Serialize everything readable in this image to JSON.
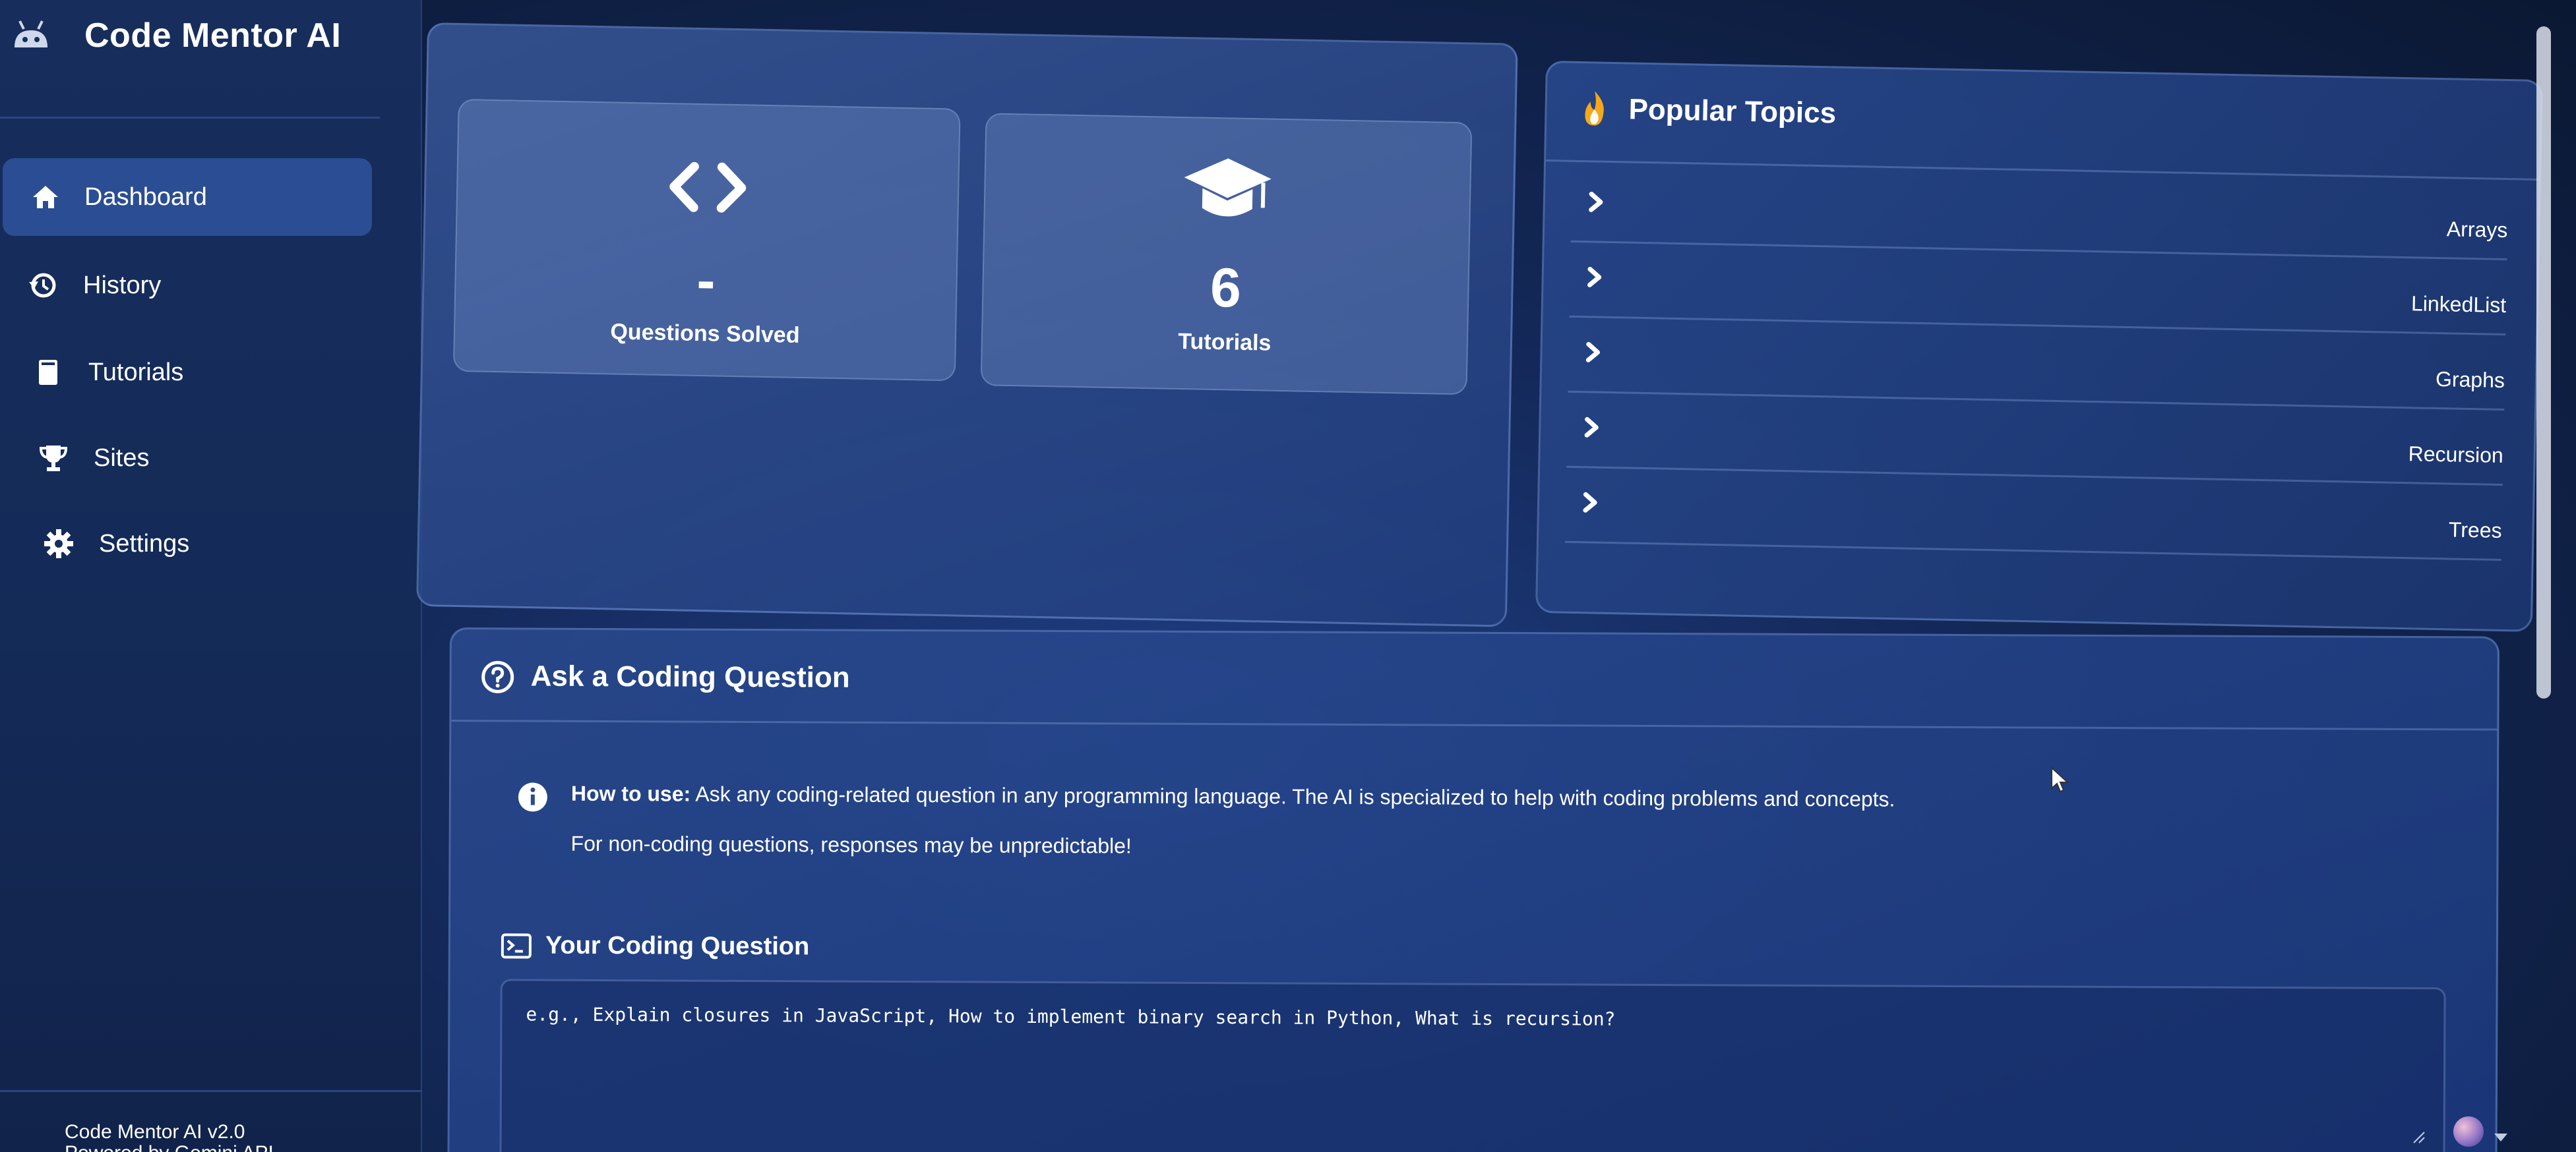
{
  "app": {
    "title": "Code Mentor AI",
    "brand_icon": "android-icon",
    "accent": "#2b4d93",
    "background": "#14295a"
  },
  "sidebar": {
    "items": [
      {
        "label": "Dashboard",
        "icon": "home-icon",
        "active": true
      },
      {
        "label": "History",
        "icon": "history-icon",
        "active": false
      },
      {
        "label": "Tutorials",
        "icon": "book-icon",
        "active": false
      },
      {
        "label": "Sites",
        "icon": "trophy-icon",
        "active": false
      },
      {
        "label": "Settings",
        "icon": "gear-icon",
        "active": false
      }
    ],
    "footer": {
      "version": "Code Mentor AI v2.0",
      "powered": "Powered by Gemini API"
    }
  },
  "stats": {
    "questions": {
      "value": "-",
      "label": "Questions Solved",
      "icon": "code-icon"
    },
    "tutorials": {
      "value": "6",
      "label": "Tutorials",
      "icon": "graduation-cap-icon"
    }
  },
  "topics": {
    "title": "Popular Topics",
    "icon": "fire-icon",
    "items": [
      "Arrays",
      "LinkedList",
      "Graphs",
      "Recursion",
      "Trees"
    ]
  },
  "ask": {
    "title": "Ask a Coding Question",
    "icon": "question-circle-icon",
    "info_label": "How to use:",
    "info_text": " Ask any coding-related question in any programming language. The AI is specialized to help with coding problems and concepts.",
    "info_note": "For non-coding questions, responses may be unpredictable!",
    "field_label": "Your Coding Question",
    "field_icon": "terminal-icon",
    "placeholder": "e.g., Explain closures in JavaScript, How to implement binary search in Python, What is recursion?",
    "value": ""
  }
}
